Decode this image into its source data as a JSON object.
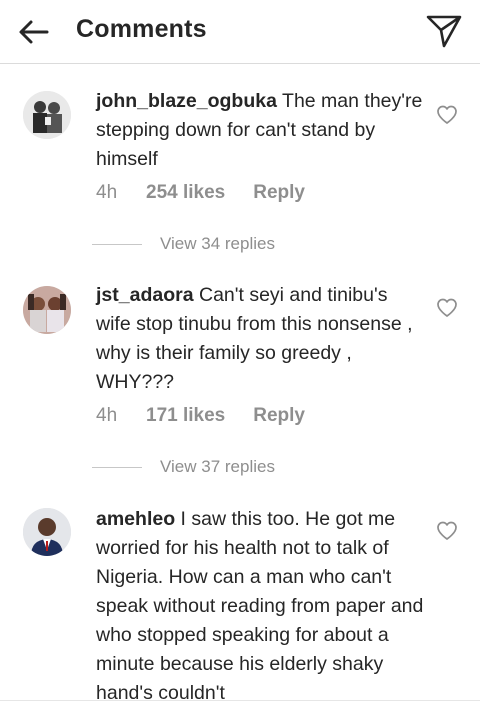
{
  "header": {
    "title": "Comments"
  },
  "comments": [
    {
      "username": "john_blaze_ogbuka",
      "text": "The man they're stepping down for can't stand by himself",
      "time": "4h",
      "likes": "254 likes",
      "reply": "Reply",
      "view_replies": "View 34 replies"
    },
    {
      "username": "jst_adaora",
      "text": "Can't seyi and tinibu's wife stop tinubu from this nonsense , why is their family so greedy , WHY???",
      "time": "4h",
      "likes": "171 likes",
      "reply": "Reply",
      "view_replies": "View 37 replies"
    },
    {
      "username": "amehleo",
      "text": "I saw this too. He got me worried for his health not to talk of Nigeria. How can a man who can't speak without reading from paper and who stopped speaking for about a minute because his elderly shaky hand's couldn't"
    }
  ],
  "icons": {
    "back": "arrow-left-icon",
    "send": "paper-plane-icon",
    "like": "heart-icon"
  },
  "colors": {
    "text": "#262626",
    "secondary": "#8e8e8e",
    "divider": "#dbdbdb"
  }
}
